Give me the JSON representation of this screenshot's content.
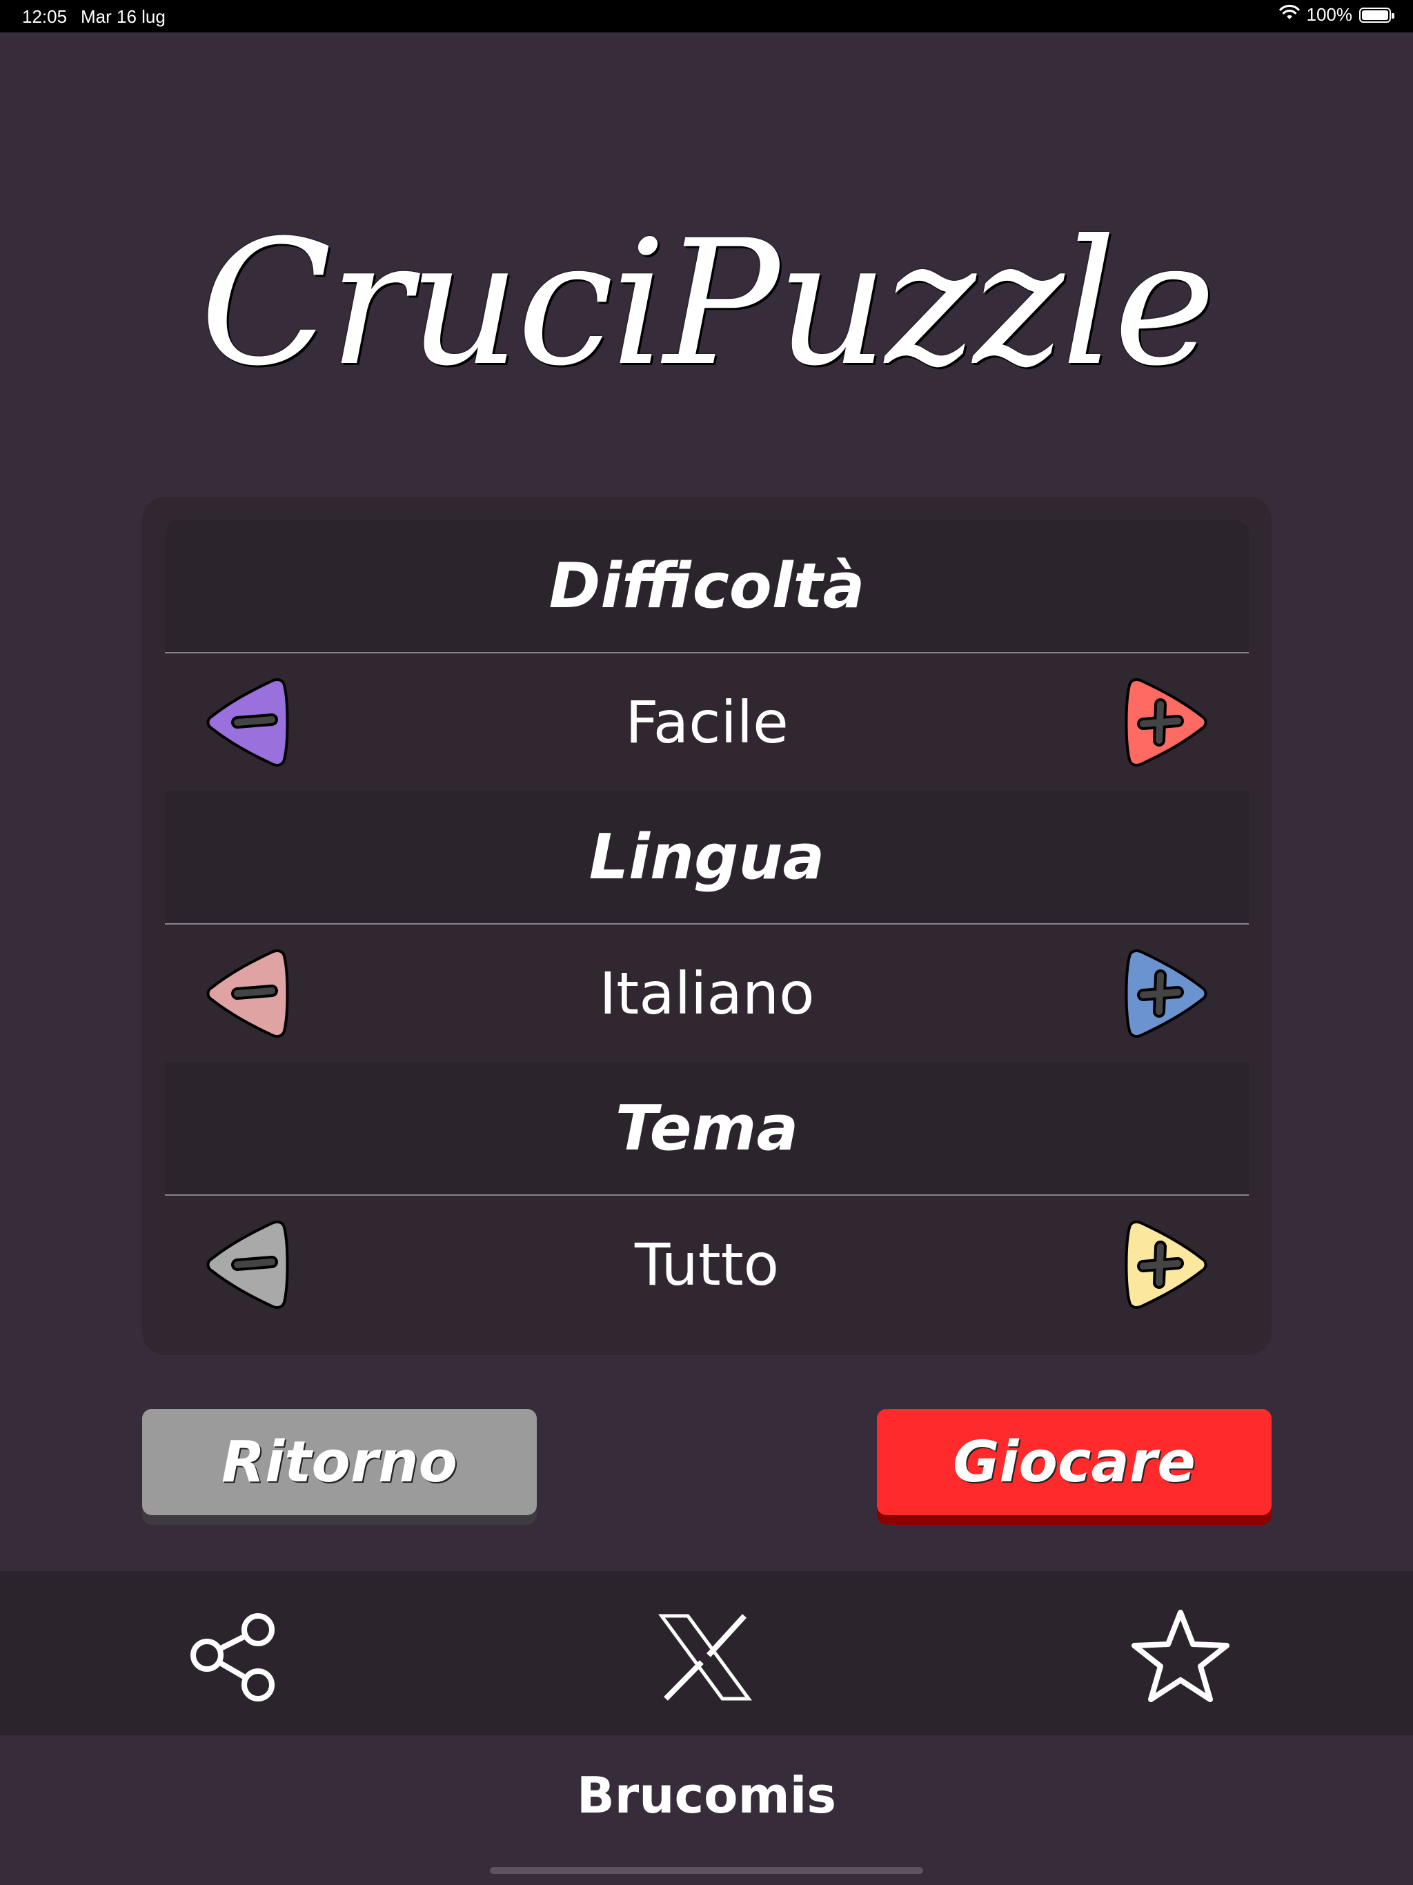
{
  "status_bar": {
    "time": "12:05",
    "date": "Mar 16 lug",
    "battery": "100%",
    "battery_level": 1.0
  },
  "app": {
    "title": "CruciPuzzle",
    "brand": "Brucomis"
  },
  "settings": [
    {
      "label": "Difficoltà",
      "value": "Facile",
      "decrease_color": "#9a70dc",
      "increase_color": "#ff6b63"
    },
    {
      "label": "Lingua",
      "value": "Italiano",
      "decrease_color": "#dfa3a4",
      "increase_color": "#6b93d0"
    },
    {
      "label": "Tema",
      "value": "Tutto",
      "decrease_color": "#a9a9a9",
      "increase_color": "#fbe89e"
    }
  ],
  "buttons": {
    "back_label": "Ritorno",
    "play_label": "Giocare",
    "back_color": "#9b9b9b",
    "play_color": "#ff2a2c"
  },
  "footer_icons": [
    "share-icon",
    "x-logo-icon",
    "star-icon"
  ],
  "colors": {
    "background": "#372c39",
    "panel": "#302730",
    "header": "#2b242c"
  }
}
